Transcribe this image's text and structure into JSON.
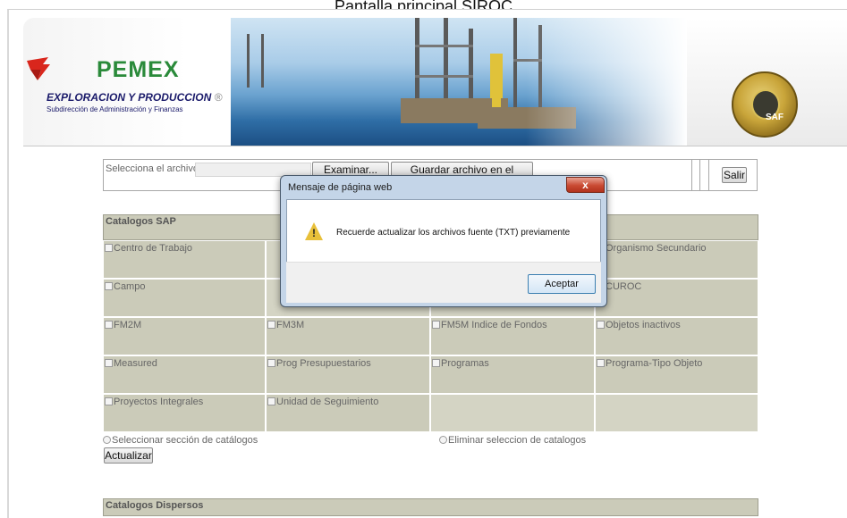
{
  "page": {
    "title": "Pantalla principal SIROC"
  },
  "header": {
    "brand": "PEMEX",
    "division": "EXPLORACION Y PRODUCCION",
    "registered": "®",
    "subdivision": "Subdirección de Administración y Finanzas",
    "seal_text": "SAF"
  },
  "upload": {
    "label": "Selecciona el archivo:",
    "browse_label": "Examinar...",
    "upload_label": "Guardar archivo en el servidor",
    "exit_label": "Salir"
  },
  "catalogs_sap": {
    "title": "Catalogos SAP",
    "items": [
      "Centro de Trabajo",
      "",
      "",
      "Organismo Secundario",
      "Campo",
      "",
      "",
      "CUROC",
      "FM2M",
      "FM3M",
      "FM5M Indice de Fondos",
      "Objetos inactivos",
      "Measured",
      "Prog Presupuestarios",
      "Programas",
      "Programa-Tipo Objeto",
      "Proyectos Integrales",
      "Unidad de Seguimiento",
      "",
      ""
    ],
    "select_all_label": "Seleccionar sección de catálogos",
    "clear_label": "Eliminar seleccion de catalogos",
    "update_label": "Actualizar"
  },
  "catalogs_dispersed": {
    "title": "Catalogos Dispersos"
  },
  "dialog": {
    "title": "Mensaje de página web",
    "close_label": "x",
    "message": "Recuerde actualizar los archivos fuente (TXT) previamente",
    "ok_label": "Aceptar"
  }
}
